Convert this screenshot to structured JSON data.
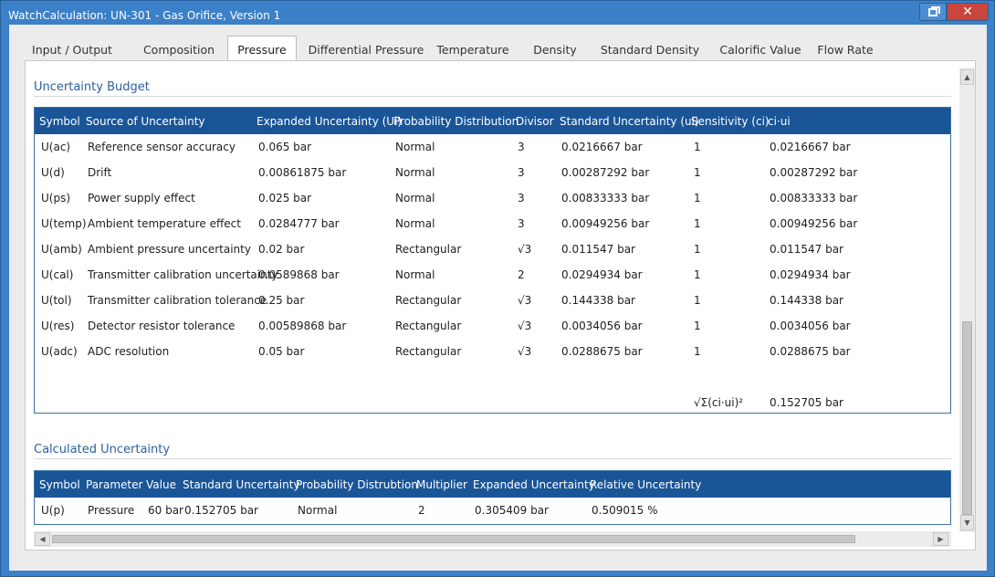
{
  "window": {
    "title": "WatchCalculation: UN-301 - Gas Orifice, Version 1",
    "restore_icon": "restore-icon",
    "close_icon": "close-icon",
    "close_glyph": "✕"
  },
  "tabs": [
    {
      "label": "Input / Output"
    },
    {
      "label": "Composition"
    },
    {
      "label": "Pressure"
    },
    {
      "label": "Differential Pressure"
    },
    {
      "label": "Temperature"
    },
    {
      "label": "Density"
    },
    {
      "label": "Standard Density"
    },
    {
      "label": "Calorific Value"
    },
    {
      "label": "Flow Rate"
    }
  ],
  "active_tab": "Pressure",
  "budget": {
    "title": "Uncertainty Budget",
    "headers": {
      "symbol": "Symbol",
      "source": "Source of Uncertainty",
      "expanded": "Expanded Uncertainty (Ui)",
      "distribution": "Probability Distribution",
      "divisor": "Divisor",
      "standard": "Standard Uncertainty (ui)",
      "sensitivity": "Sensitivity (ci)",
      "ciui": "ci·ui"
    },
    "rows": [
      {
        "symbol": "U(ac)",
        "source": "Reference sensor accuracy",
        "expanded": "0.065 bar",
        "distribution": "Normal",
        "divisor": "3",
        "standard": "0.0216667 bar",
        "sensitivity": "1",
        "ciui": "0.0216667 bar"
      },
      {
        "symbol": "U(d)",
        "source": "Drift",
        "expanded": "0.00861875 bar",
        "distribution": "Normal",
        "divisor": "3",
        "standard": "0.00287292 bar",
        "sensitivity": "1",
        "ciui": "0.00287292 bar"
      },
      {
        "symbol": "U(ps)",
        "source": "Power supply effect",
        "expanded": "0.025 bar",
        "distribution": "Normal",
        "divisor": "3",
        "standard": "0.00833333 bar",
        "sensitivity": "1",
        "ciui": "0.00833333 bar"
      },
      {
        "symbol": "U(temp)",
        "source": "Ambient temperature effect",
        "expanded": "0.0284777 bar",
        "distribution": "Normal",
        "divisor": "3",
        "standard": "0.00949256 bar",
        "sensitivity": "1",
        "ciui": "0.00949256 bar"
      },
      {
        "symbol": "U(amb)",
        "source": "Ambient pressure uncertainty",
        "expanded": "0.02 bar",
        "distribution": "Rectangular",
        "divisor": "√3",
        "standard": "0.011547 bar",
        "sensitivity": "1",
        "ciui": "0.011547 bar"
      },
      {
        "symbol": "U(cal)",
        "source": "Transmitter calibration uncertainty",
        "expanded": "0.0589868 bar",
        "distribution": "Normal",
        "divisor": "2",
        "standard": "0.0294934 bar",
        "sensitivity": "1",
        "ciui": "0.0294934 bar"
      },
      {
        "symbol": "U(tol)",
        "source": "Transmitter calibration tolerance",
        "expanded": "0.25 bar",
        "distribution": "Rectangular",
        "divisor": "√3",
        "standard": "0.144338 bar",
        "sensitivity": "1",
        "ciui": "0.144338 bar"
      },
      {
        "symbol": "U(res)",
        "source": "Detector resistor tolerance",
        "expanded": "0.00589868 bar",
        "distribution": "Rectangular",
        "divisor": "√3",
        "standard": "0.0034056 bar",
        "sensitivity": "1",
        "ciui": "0.0034056 bar"
      },
      {
        "symbol": "U(adc)",
        "source": "ADC resolution",
        "expanded": "0.05 bar",
        "distribution": "Rectangular",
        "divisor": "√3",
        "standard": "0.0288675 bar",
        "sensitivity": "1",
        "ciui": "0.0288675 bar"
      }
    ],
    "total_label": "√Σ(ci·ui)²",
    "total_value": "0.152705 bar"
  },
  "calculated": {
    "title": "Calculated Uncertainty",
    "headers": {
      "symbol": "Symbol",
      "parameter": "Parameter",
      "value": "Value",
      "standard": "Standard Uncertainty",
      "distribution": "Probability Distrubtion",
      "multiplier": "Multiplier",
      "expanded": "Expanded Uncertainty",
      "relative": "Relative Uncertainty"
    },
    "rows": [
      {
        "symbol": "U(p)",
        "parameter": "Pressure",
        "value": "60 bar",
        "standard": "0.152705 bar",
        "distribution": "Normal",
        "multiplier": "2",
        "expanded": "0.305409 bar",
        "relative": "0.509015 %"
      }
    ]
  },
  "scrollbars": {
    "up_icon": "▲",
    "down_icon": "▼",
    "left_icon": "◀",
    "right_icon": "▶"
  },
  "colors": {
    "header_bg": "#1a5597",
    "section_title": "#2b5f9b",
    "window_frame": "#3b80c8",
    "close_button": "#c9463d"
  }
}
